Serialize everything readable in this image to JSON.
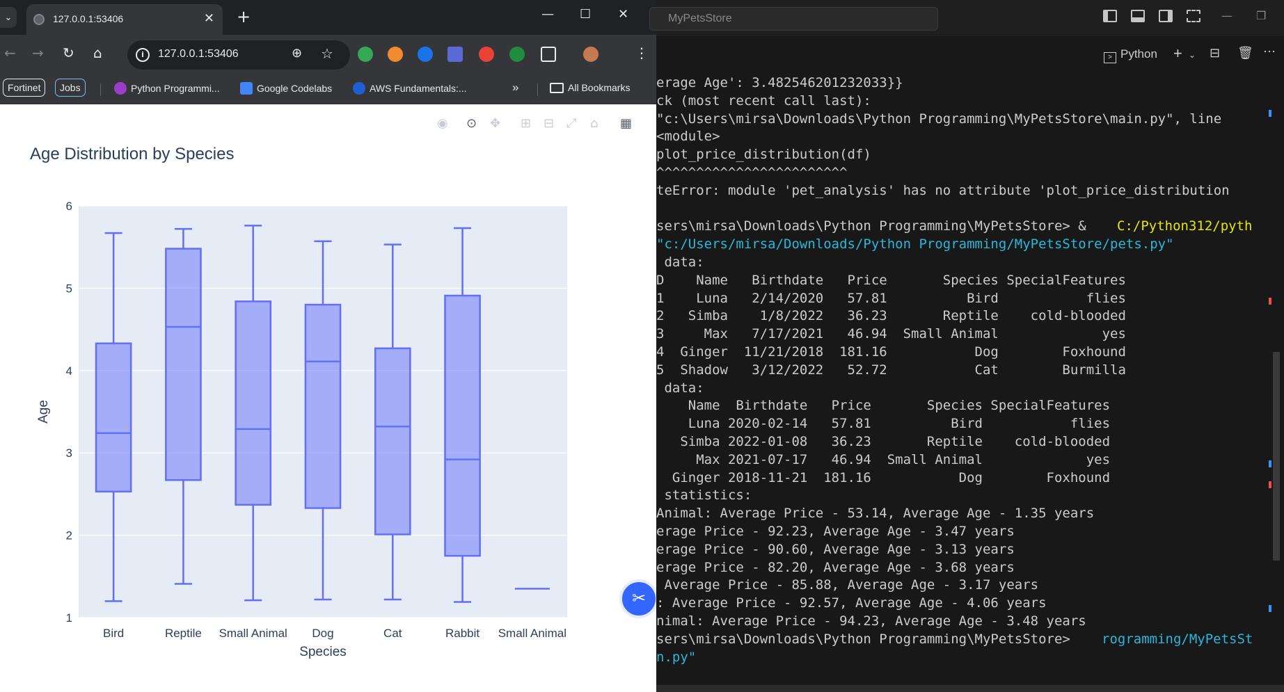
{
  "browser": {
    "tab_title": "127.0.0.1:53406",
    "url": "127.0.0.1:53406",
    "bookmarks": {
      "chip1": "Fortinet",
      "chip2": "Jobs",
      "item1": "Python Programmi...",
      "item2": "Google Codelabs",
      "item3": "AWS Fundamentals:...",
      "overflow": "»",
      "all": "All Bookmarks"
    }
  },
  "chart_data": {
    "type": "box",
    "title": "Age Distribution by Species",
    "xlabel": "Species",
    "ylabel": "Age",
    "ylim": [
      1,
      6
    ],
    "yticks": [
      "1",
      "2",
      "3",
      "4",
      "5",
      "6"
    ],
    "grid": true,
    "color": "#636efa",
    "categories": [
      "Bird",
      "Reptile",
      "Small Animal",
      "Dog",
      "Cat",
      "Rabbit",
      "Small Animal"
    ],
    "boxes": [
      {
        "min": 1.2,
        "q1": 2.53,
        "median": 3.24,
        "q3": 4.33,
        "max": 5.67
      },
      {
        "min": 1.41,
        "q1": 2.67,
        "median": 4.53,
        "q3": 5.48,
        "max": 5.72
      },
      {
        "min": 1.21,
        "q1": 2.37,
        "median": 3.29,
        "q3": 4.84,
        "max": 5.76
      },
      {
        "min": 1.22,
        "q1": 2.33,
        "median": 4.11,
        "q3": 4.8,
        "max": 5.57
      },
      {
        "min": 1.22,
        "q1": 2.01,
        "median": 3.32,
        "q3": 4.27,
        "max": 5.53
      },
      {
        "min": 1.19,
        "q1": 1.75,
        "median": 2.92,
        "q3": 4.91,
        "max": 5.73
      },
      {
        "min": 1.35,
        "q1": 1.35,
        "median": 1.35,
        "q3": 1.35,
        "max": 1.35
      }
    ]
  },
  "terminal": {
    "search_placeholder": "MyPetsStore",
    "shell_label": "Python",
    "lines": [
      "erage Age': 3.482546201232033}}",
      "ck (most recent call last):",
      "\"c:\\Users\\mirsa\\Downloads\\Python Programming\\MyPetsStore\\main.py\", line",
      "<module>",
      "plot_price_distribution(df)",
      "^^^^^^^^^^^^^^^^^^^^^^^^",
      "teError: module 'pet_analysis' has no attribute 'plot_price_distribution",
      "",
      "sers\\mirsa\\Downloads\\Python Programming\\MyPetsStore> & ",
      "\"c:/Users/mirsa/Downloads/Python Programming/MyPetsStore/pets.py\"",
      " data:",
      "D    Name   Birthdate   Price       Species SpecialFeatures",
      "1    Luna   2/14/2020   57.81          Bird           flies",
      "2   Simba    1/8/2022   36.23       Reptile    cold-blooded",
      "3     Max   7/17/2021   46.94  Small Animal             yes",
      "4  Ginger  11/21/2018  181.16           Dog        Foxhound",
      "5  Shadow   3/12/2022   52.72           Cat        Burmilla",
      " data:",
      "    Name  Birthdate   Price       Species SpecialFeatures",
      "    Luna 2020-02-14   57.81          Bird           flies",
      "   Simba 2022-01-08   36.23       Reptile    cold-blooded",
      "     Max 2021-07-17   46.94  Small Animal             yes",
      "  Ginger 2018-11-21  181.16           Dog        Foxhound",
      " statistics:",
      "Animal: Average Price - 53.14, Average Age - 1.35 years",
      "erage Price - 92.23, Average Age - 3.47 years",
      "erage Price - 90.60, Average Age - 3.13 years",
      "erage Price - 82.20, Average Age - 3.68 years",
      " Average Price - 85.88, Average Age - 3.17 years",
      ": Average Price - 92.57, Average Age - 4.06 years",
      "nimal: Average Price - 94.23, Average Age - 3.48 years",
      "sers\\mirsa\\Downloads\\Python Programming\\MyPetsStore> ",
      "n.py\""
    ],
    "path_highlight": "C:/Python312/pyth",
    "path_highlight2": "rogramming/MyPetsSt"
  }
}
